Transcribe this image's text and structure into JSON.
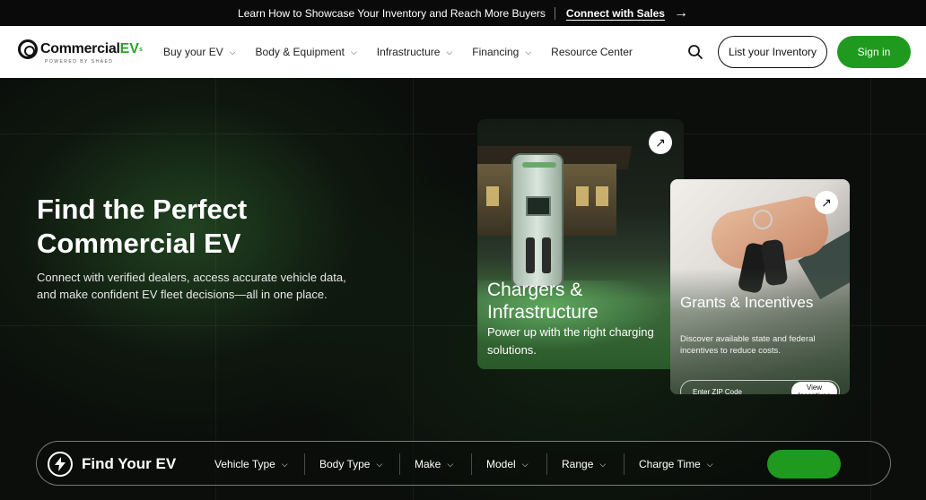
{
  "promo": {
    "message": "Learn How to Showcase Your Inventory and Reach More Buyers",
    "cta": "Connect with Sales",
    "arrow": "→"
  },
  "brand": {
    "name": "Commercial",
    "ev": "EV",
    "sup": "s",
    "tagline": "POWERED BY SHAED",
    "accent": "#1f9a1f"
  },
  "nav": {
    "items": [
      {
        "label": "Buy your EV",
        "has_dropdown": true
      },
      {
        "label": "Body & Equipment",
        "has_dropdown": true
      },
      {
        "label": "Infrastructure",
        "has_dropdown": true
      },
      {
        "label": "Financing",
        "has_dropdown": true
      },
      {
        "label": "Resource Center",
        "has_dropdown": false
      }
    ],
    "search_icon": "search-icon",
    "list_inventory": "List your Inventory",
    "sign_in": "Sign in"
  },
  "hero": {
    "title": "Find the Perfect Commercial EV",
    "subtitle": "Connect with verified dealers, access accurate vehicle data, and make confident EV fleet decisions—all in one place."
  },
  "cards": {
    "chargers": {
      "title": "Chargers & Infrastructure",
      "text": "Power up with the right charging solutions."
    },
    "incentives": {
      "title": "Grants & Incentives",
      "text": "Discover available state and federal incentives to reduce costs.",
      "zip_placeholder": "Enter ZIP Code",
      "button": "View Incentives"
    }
  },
  "finder": {
    "title": "Find Your EV",
    "filters": [
      "Vehicle Type",
      "Body Type",
      "Make",
      "Model",
      "Range",
      "Charge Time"
    ],
    "go_button": ""
  }
}
